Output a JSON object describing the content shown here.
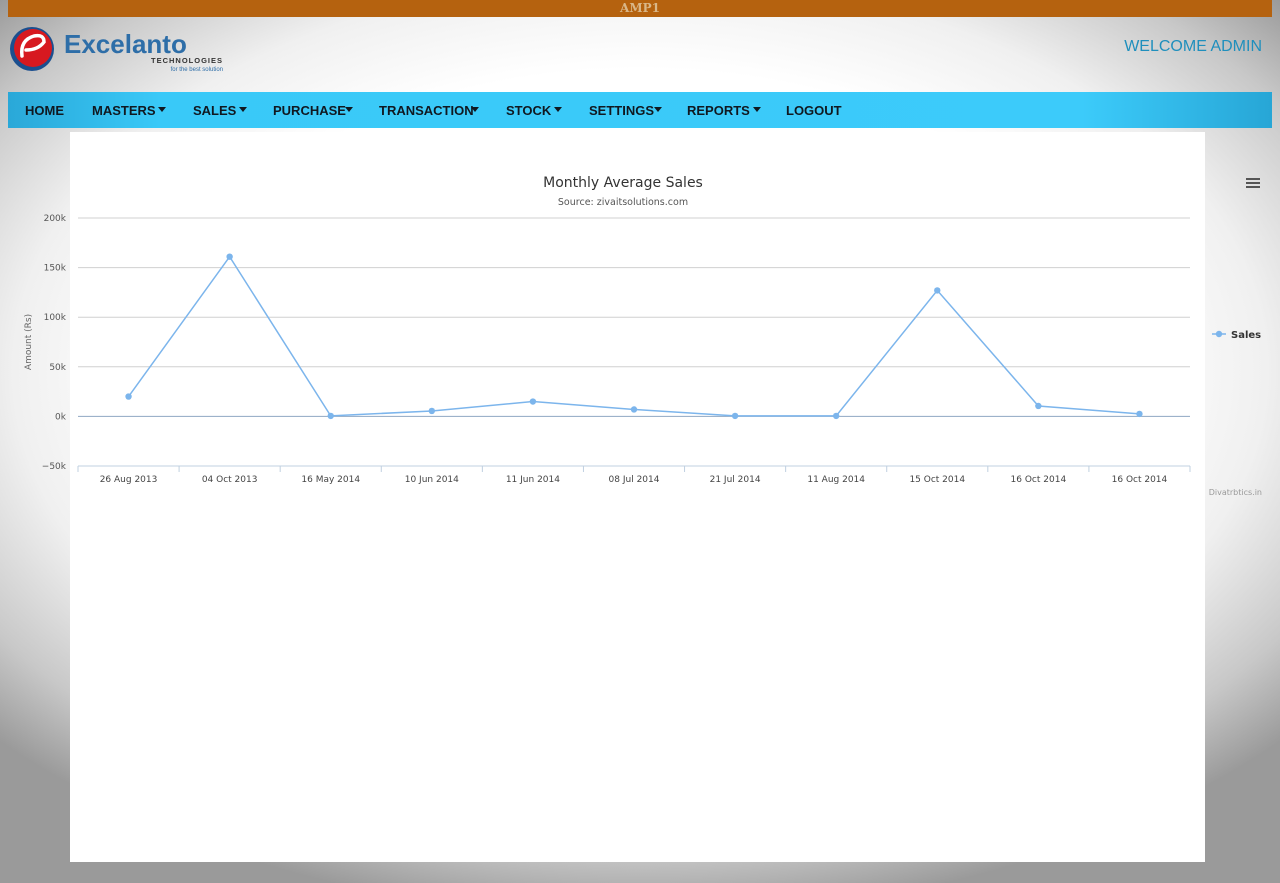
{
  "header": {
    "top_label": "AMP1",
    "logo_name": "Excelanto",
    "logo_sub": "TECHNOLOGIES",
    "logo_tagline": "for the best solution",
    "welcome_text": "WELCOME ADMIN"
  },
  "nav": [
    {
      "label": "HOME",
      "dropdown": false
    },
    {
      "label": "MASTERS",
      "dropdown": true
    },
    {
      "label": "SALES",
      "dropdown": true
    },
    {
      "label": "PURCHASE",
      "dropdown": true
    },
    {
      "label": "TRANSACTION",
      "dropdown": true
    },
    {
      "label": "STOCK",
      "dropdown": true
    },
    {
      "label": "SETTINGS",
      "dropdown": true
    },
    {
      "label": "REPORTS",
      "dropdown": true
    },
    {
      "label": "LOGOUT",
      "dropdown": false
    }
  ],
  "colors": {
    "topbar": "#b5620f",
    "navbar": "#39c9f8",
    "welcome": "#1f8fbd",
    "series": "#7cb5ec"
  },
  "chart_menu_icon": "hamburger-icon",
  "chart_data": {
    "type": "line",
    "title": "Monthly Average Sales",
    "subtitle": "Source: zivaitsolutions.com",
    "xlabel": "",
    "ylabel": "Amount (Rs)",
    "ylim": [
      -50000,
      200000
    ],
    "yticks": [
      -50000,
      0,
      50000,
      100000,
      150000,
      200000
    ],
    "ytick_labels": [
      "−50k",
      "0k",
      "50k",
      "100k",
      "150k",
      "200k"
    ],
    "categories": [
      "26 Aug 2013",
      "04 Oct 2013",
      "16 May 2014",
      "10 Jun 2014",
      "11 Jun 2014",
      "08 Jul 2014",
      "21 Jul 2014",
      "11 Aug 2014",
      "15 Oct 2014",
      "16 Oct 2014",
      "16 Oct 2014"
    ],
    "series": [
      {
        "name": "Sales",
        "values": [
          20000,
          161000,
          500,
          5500,
          15000,
          7000,
          500,
          500,
          127000,
          10500,
          2500
        ]
      }
    ],
    "grid": true,
    "legend_position": "right",
    "credits": "Divatrbtics.in"
  }
}
